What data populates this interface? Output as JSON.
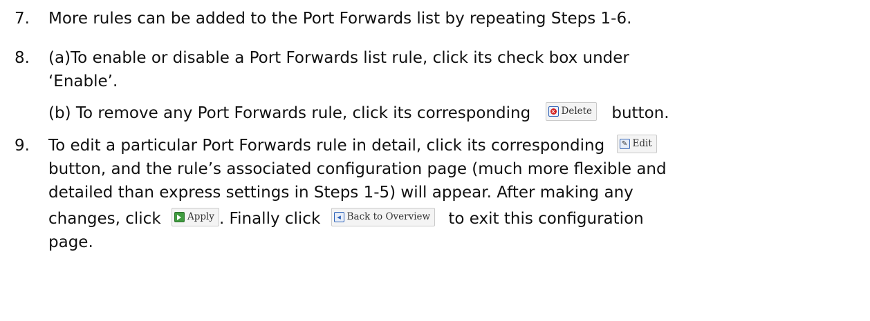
{
  "items": [
    {
      "number": "7.",
      "lines": [
        "More rules can be added to the Port Forwards list by repeating Steps 1-6."
      ]
    },
    {
      "number": "8.",
      "lines": [
        "(a)To enable or disable a Port Forwards list rule, click its check box under",
        "‘Enable’.",
        "(b) To remove any Port Forwards rule, click its corresponding",
        "button."
      ]
    },
    {
      "number": "9.",
      "lines": [
        "To edit a particular Port Forwards rule in detail, click its corresponding",
        "button, and the rule’s associated configuration page (much more flexible and",
        "detailed than express settings in Steps 1-5) will appear. After making any",
        "changes, click",
        ". Finally click",
        "to exit this configuration",
        "page."
      ]
    }
  ],
  "buttons": {
    "delete": {
      "label": "Delete",
      "icon": "delete-icon"
    },
    "edit": {
      "label": "Edit",
      "icon": "edit-icon"
    },
    "apply": {
      "label": "Apply",
      "icon": "apply-icon"
    },
    "back_to_overview": {
      "label": "Back to Overview",
      "icon": "back-arrow-icon"
    }
  }
}
